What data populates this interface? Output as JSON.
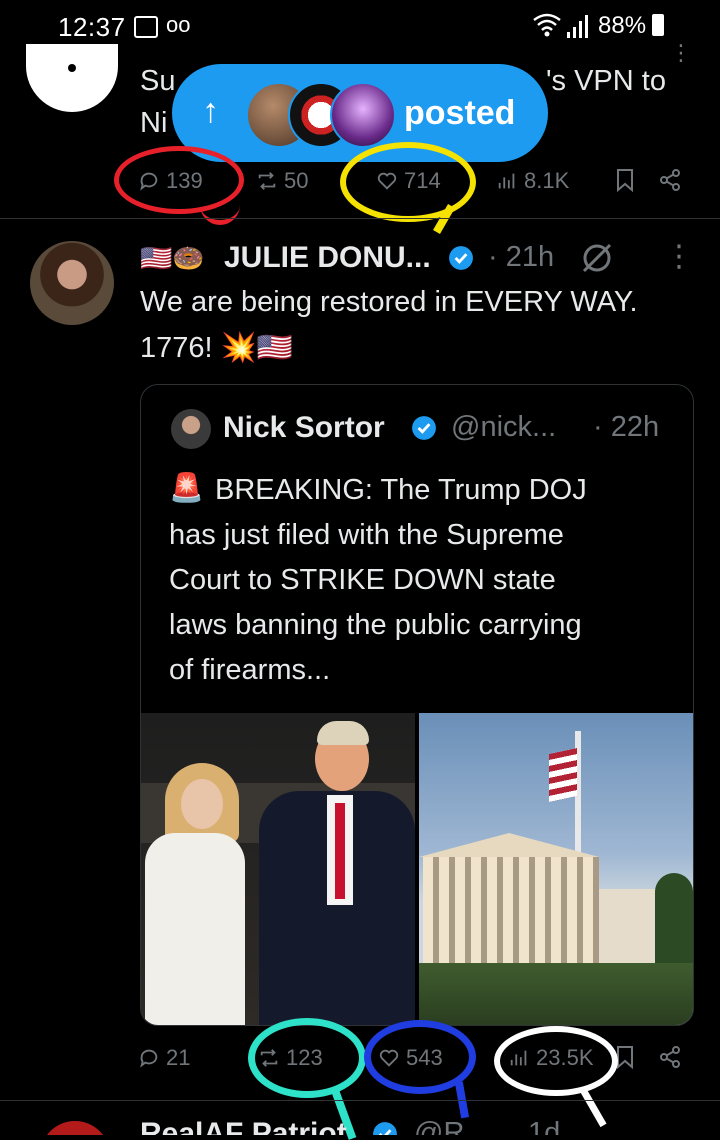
{
  "status_bar": {
    "time": "12:37",
    "battery": "88%"
  },
  "tweet1": {
    "text_line1_left": "Su",
    "text_line1_right": "'s VPN to",
    "text_line2_left": "Ni",
    "replies": "139",
    "reposts": "50",
    "likes": "714",
    "views": "8.1K"
  },
  "pill": {
    "label": "posted"
  },
  "tweet2": {
    "flags": "🇺🇸🍩",
    "author": "JULIE DONU...",
    "time": "· 21h",
    "text_line1": "We are being restored in EVERY WAY.",
    "text_line2": "1776! 💥🇺🇸",
    "replies": "21",
    "reposts": "123",
    "likes": "543",
    "views": "23.5K"
  },
  "quote": {
    "author": "Nick Sortor",
    "handle": "@nick...",
    "time": "· 22h",
    "emoji": "🚨",
    "lines": [
      "BREAKING: The Trump DOJ",
      "has just filed with the Supreme",
      "Court to STRIKE DOWN state",
      "laws banning the public carrying",
      "of firearms..."
    ]
  },
  "tweet3": {
    "author": "RealAF Patriot",
    "handle": "@R",
    "time": "1d"
  },
  "colors": {
    "accent": "#1d9bf0",
    "background": "#000000",
    "muted": "#71767b",
    "annot_red": "#e8202a",
    "annot_yellow": "#f5e200",
    "annot_cyan": "#2de2c8",
    "annot_blue": "#1f3de0",
    "annot_white": "#ffffff"
  }
}
